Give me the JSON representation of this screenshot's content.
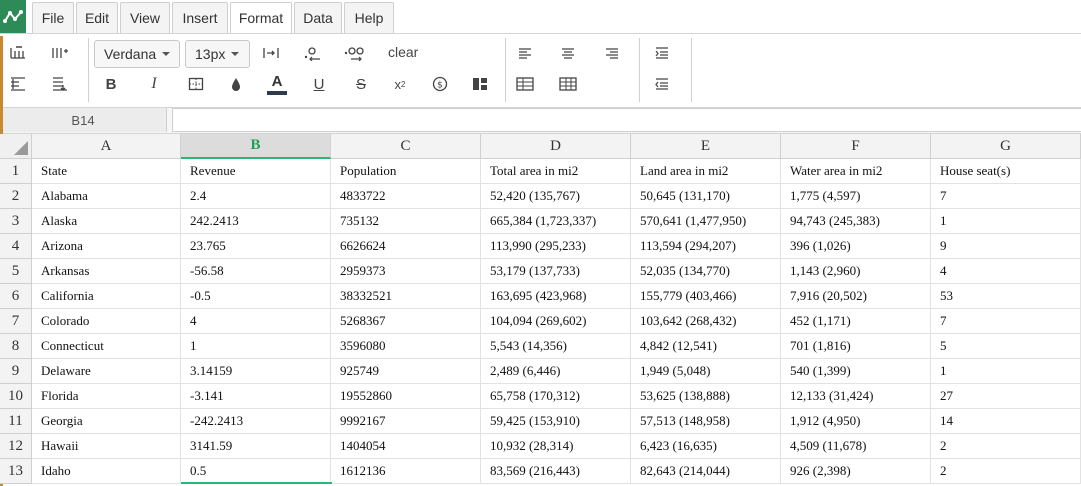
{
  "menu": {
    "items": [
      {
        "label": "File",
        "active": false
      },
      {
        "label": "Edit",
        "active": false
      },
      {
        "label": "View",
        "active": false
      },
      {
        "label": "Insert",
        "active": false
      },
      {
        "label": "Format",
        "active": true
      },
      {
        "label": "Data",
        "active": false
      },
      {
        "label": "Help",
        "active": false
      }
    ]
  },
  "toolbar": {
    "font_family": "Verdana",
    "font_size": "13px",
    "clear_label": "clear",
    "text_color": "#222222",
    "accent_color": "#2bb673"
  },
  "formula_bar": {
    "cell_ref": "B14",
    "value": ""
  },
  "grid": {
    "columns": [
      "A",
      "B",
      "C",
      "D",
      "E",
      "F",
      "G"
    ],
    "selected_column": "B",
    "row_numbers": [
      "1",
      "2",
      "3",
      "4",
      "5",
      "6",
      "7",
      "8",
      "9",
      "10",
      "11",
      "12",
      "13"
    ],
    "rows": [
      [
        "State",
        "Revenue",
        "Population",
        "Total area in mi2",
        "Land area in mi2",
        "Water area in mi2",
        "House seat(s)"
      ],
      [
        "Alabama",
        "2.4",
        "4833722",
        "52,420 (135,767)",
        "50,645 (131,170)",
        "1,775 (4,597)",
        "7"
      ],
      [
        "Alaska",
        "242.2413",
        "735132",
        "665,384 (1,723,337)",
        "570,641 (1,477,950)",
        "94,743 (245,383)",
        "1"
      ],
      [
        "Arizona",
        "23.765",
        "6626624",
        "113,990 (295,233)",
        "113,594 (294,207)",
        "396 (1,026)",
        "9"
      ],
      [
        "Arkansas",
        "-56.58",
        "2959373",
        "53,179 (137,733)",
        "52,035 (134,770)",
        "1,143 (2,960)",
        "4"
      ],
      [
        "California",
        "-0.5",
        "38332521",
        "163,695 (423,968)",
        "155,779 (403,466)",
        "7,916 (20,502)",
        "53"
      ],
      [
        "Colorado",
        "4",
        "5268367",
        "104,094 (269,602)",
        "103,642 (268,432)",
        "452 (1,171)",
        "7"
      ],
      [
        "Connecticut",
        "1",
        "3596080",
        "5,543 (14,356)",
        "4,842 (12,541)",
        "701 (1,816)",
        "5"
      ],
      [
        "Delaware",
        "3.14159",
        "925749",
        "2,489 (6,446)",
        "1,949 (5,048)",
        "540 (1,399)",
        "1"
      ],
      [
        "Florida",
        "-3.141",
        "19552860",
        "65,758 (170,312)",
        "53,625 (138,888)",
        "12,133 (31,424)",
        "27"
      ],
      [
        "Georgia",
        "-242.2413",
        "9992167",
        "59,425 (153,910)",
        "57,513 (148,958)",
        "1,912 (4,950)",
        "14"
      ],
      [
        "Hawaii",
        "3141.59",
        "1404054",
        "10,932 (28,314)",
        "6,423 (16,635)",
        "4,509 (11,678)",
        "2"
      ],
      [
        "Idaho",
        "0.5",
        "1612136",
        "83,569 (216,443)",
        "82,643 (214,044)",
        "926 (2,398)",
        "2"
      ]
    ]
  }
}
